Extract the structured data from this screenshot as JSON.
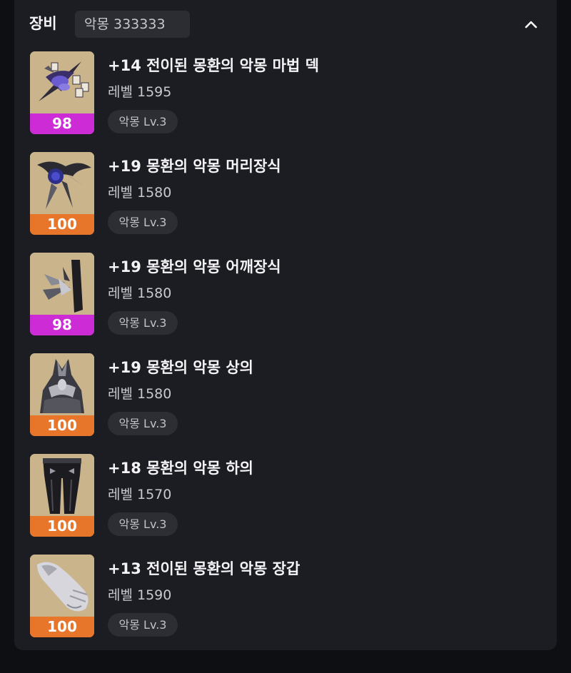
{
  "header": {
    "title": "장비",
    "badge": "악몽 333333"
  },
  "colors": {
    "quality_purple": "#cc2bd6",
    "quality_orange": "#e8762a",
    "panel_bg": "#1c1d22",
    "thumb_bg": "#c7b28a"
  },
  "items": [
    {
      "name": "+14 전이된 몽환의 악몽 마법 덱",
      "level": "레벨 1595",
      "quality": "98",
      "quality_color": "purple",
      "tag": "악몽 Lv.3",
      "icon": "magic-deck-icon"
    },
    {
      "name": "+19 몽환의 악몽 머리장식",
      "level": "레벨 1580",
      "quality": "100",
      "quality_color": "orange",
      "tag": "악몽 Lv.3",
      "icon": "head-ornament-icon"
    },
    {
      "name": "+19 몽환의 악몽 어깨장식",
      "level": "레벨 1580",
      "quality": "98",
      "quality_color": "purple",
      "tag": "악몽 Lv.3",
      "icon": "shoulder-ornament-icon"
    },
    {
      "name": "+19 몽환의 악몽 상의",
      "level": "레벨 1580",
      "quality": "100",
      "quality_color": "orange",
      "tag": "악몽 Lv.3",
      "icon": "chest-armor-icon"
    },
    {
      "name": "+18 몽환의 악몽 하의",
      "level": "레벨 1570",
      "quality": "100",
      "quality_color": "orange",
      "tag": "악몽 Lv.3",
      "icon": "leg-armor-icon"
    },
    {
      "name": "+13 전이된 몽환의 악몽 장갑",
      "level": "레벨 1590",
      "quality": "100",
      "quality_color": "orange",
      "tag": "악몽 Lv.3",
      "icon": "glove-icon"
    }
  ]
}
